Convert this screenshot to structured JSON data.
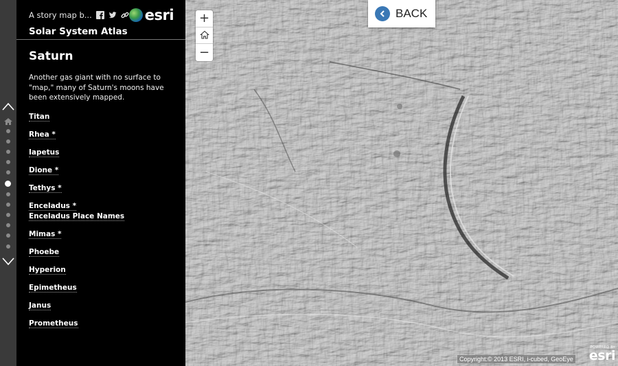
{
  "header": {
    "subtitle": "A story map b...",
    "share_icons": [
      "facebook-icon",
      "twitter-icon",
      "link-icon"
    ],
    "logo_text": "esri",
    "app_title": "Solar System Atlas"
  },
  "section": {
    "title": "Saturn",
    "description": "Another gas giant with no surface to \"map,\" many of Saturn's moons have been extensively mapped."
  },
  "moons": [
    {
      "label": "Titan"
    },
    {
      "label": "Rhea *"
    },
    {
      "label": "Iapetus"
    },
    {
      "label": "Dione *"
    },
    {
      "label": "Tethys *"
    },
    {
      "label": "Enceladus *",
      "sub": "Enceladus Place Names"
    },
    {
      "label": "Mimas *"
    },
    {
      "label": "Phoebe"
    },
    {
      "label": "Hyperion"
    },
    {
      "label": "Epimetheus"
    },
    {
      "label": "Janus"
    },
    {
      "label": "Prometheus"
    }
  ],
  "map": {
    "back_label": "BACK",
    "zoom_in": "+",
    "zoom_out": "−",
    "attribution": "Copyright:© 2013 ESRI, i-cubed, GeoEye",
    "powered_by": "POWERED BY",
    "powered_logo": "esri"
  },
  "colors": {
    "sidebar_bg": "#000000",
    "dotnav_bg": "#3a3a3a",
    "back_accent": "#3a78b5"
  }
}
